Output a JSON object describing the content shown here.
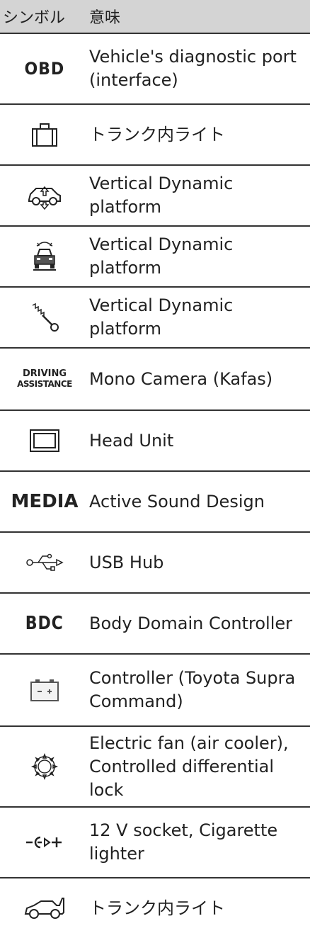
{
  "header": {
    "symbol": "シンボル",
    "meaning": "意味"
  },
  "rows": [
    {
      "icon": "obd-text-icon",
      "icon_text": "OBD",
      "meaning": "Vehicle's diagnostic port (interface)"
    },
    {
      "icon": "suitcase-icon",
      "meaning": "トランク内ライト"
    },
    {
      "icon": "car-vertical-arrows-icon",
      "meaning": "Vertical Dynamic platform"
    },
    {
      "icon": "car-front-lift-icon",
      "meaning": "Vertical Dynamic platform"
    },
    {
      "icon": "spring-shock-icon",
      "meaning": "Vertical Dynamic platform"
    },
    {
      "icon": "driving-assistance-text-icon",
      "icon_text_line1": "DRIVING",
      "icon_text_line2": "ASSISTANCE",
      "meaning": "Mono Camera (Kafas)"
    },
    {
      "icon": "screen-icon",
      "meaning": "Head Unit"
    },
    {
      "icon": "media-text-icon",
      "icon_text": "MEDIA",
      "meaning": "Active Sound Design"
    },
    {
      "icon": "usb-icon",
      "meaning": "USB Hub"
    },
    {
      "icon": "bdc-text-icon",
      "icon_text": "BDC",
      "meaning": "Body Domain Controller"
    },
    {
      "icon": "battery-box-icon",
      "meaning": "Controller (Toyota Supra Command)"
    },
    {
      "icon": "gear-icon",
      "meaning": "Electric fan (air cooler), Controlled differential lock"
    },
    {
      "icon": "socket-plug-icon",
      "meaning": "12 V socket, Cigarette lighter"
    },
    {
      "icon": "car-trunk-open-icon",
      "meaning": "トランク内ライト"
    }
  ]
}
